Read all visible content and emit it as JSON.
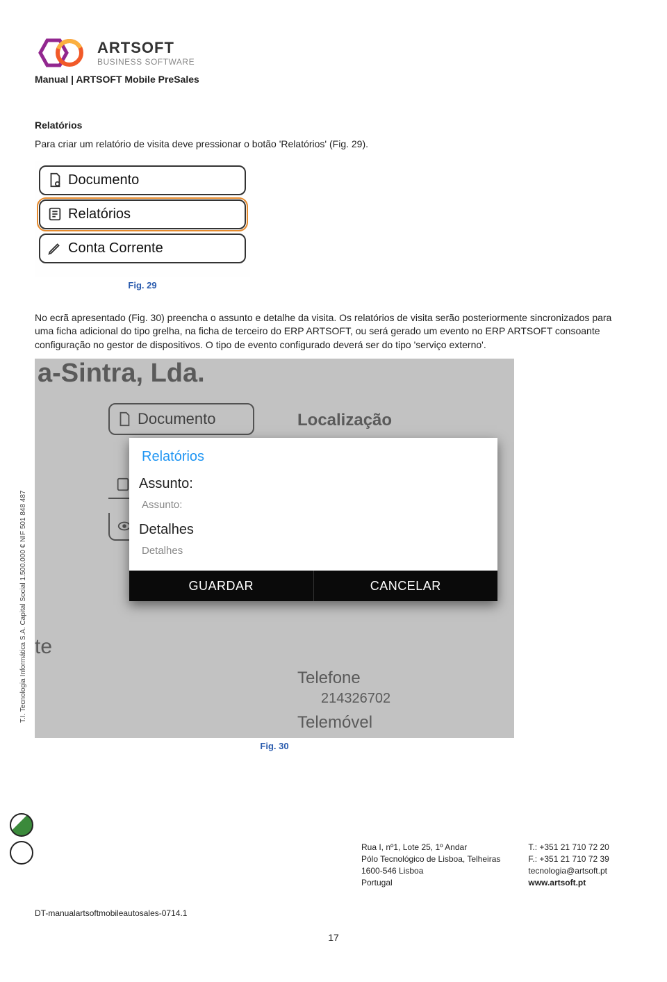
{
  "logo": {
    "brand": "ARTSOFT",
    "sub": "BUSINESS SOFTWARE"
  },
  "header_sub": "Manual | ARTSOFT Mobile PreSales",
  "section_title": "Relatórios",
  "para1": "Para criar um relatório de visita deve pressionar o botão 'Relatórios' (Fig. 29).",
  "menu29": {
    "items": [
      "Documento",
      "Relatórios",
      "Conta Corrente"
    ]
  },
  "fig29_caption": "Fig. 29",
  "para2": "No ecrã apresentado (Fig. 30) preencha o assunto e detalhe da visita. Os relatórios de visita serão posteriormente sincronizados para uma ficha adicional do tipo grelha, na ficha de terceiro do ERP ARTSOFT, ou será gerado um evento no ERP ARTSOFT consoante configuração no gestor de dispositivos. O tipo de evento configurado deverá ser do tipo 'serviço externo'.",
  "shot30": {
    "bg_top": "a-Sintra, Lda.",
    "bg_loc": "Localização",
    "bg_doc": "Documento",
    "bg_te": "te",
    "bg_tel": "Telefone",
    "bg_telnum": "214326702",
    "bg_telmov": "Telemóvel",
    "dialog": {
      "title": "Relatórios",
      "label1": "Assunto:",
      "placeholder1": "Assunto:",
      "label2": "Detalhes",
      "placeholder2": "Detalhes",
      "btn_save": "GUARDAR",
      "btn_cancel": "CANCELAR"
    }
  },
  "fig30_caption": "Fig. 30",
  "side_text": "T.I. Tecnologia Informática S.A.    Capital Social  1.500.000 €    NIF 501 848 487",
  "footer": {
    "addr": [
      "Rua I, nº1, Lote 25, 1º Andar",
      "Pólo Tecnológico de Lisboa, Telheiras",
      "1600-546 Lisboa",
      "Portugal"
    ],
    "contact": [
      "T.: +351 21 710 72 20",
      "F.: +351 21 710 72 39",
      "tecnologia@artsoft.pt",
      "www.artsoft.pt"
    ],
    "contact_bold_idx": 3
  },
  "doc_ref": "DT-manualartsoftmobileautosales-0714.1",
  "page_num": "17"
}
